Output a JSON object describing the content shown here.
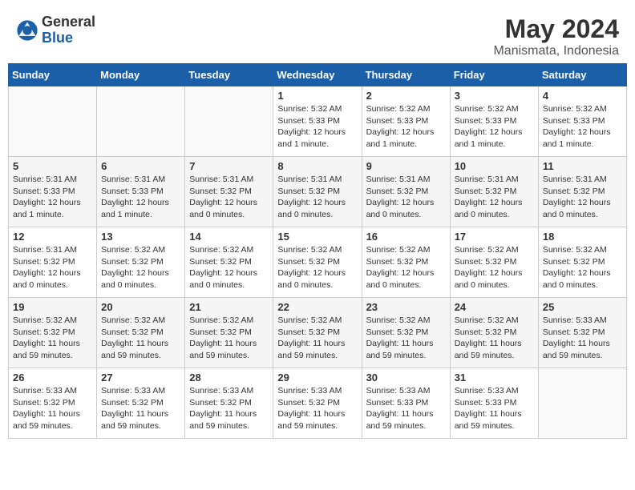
{
  "header": {
    "logo_general": "General",
    "logo_blue": "Blue",
    "month_title": "May 2024",
    "location": "Manismata, Indonesia"
  },
  "weekdays": [
    "Sunday",
    "Monday",
    "Tuesday",
    "Wednesday",
    "Thursday",
    "Friday",
    "Saturday"
  ],
  "weeks": [
    [
      {
        "day": "",
        "info": ""
      },
      {
        "day": "",
        "info": ""
      },
      {
        "day": "",
        "info": ""
      },
      {
        "day": "1",
        "info": "Sunrise: 5:32 AM\nSunset: 5:33 PM\nDaylight: 12 hours\nand 1 minute."
      },
      {
        "day": "2",
        "info": "Sunrise: 5:32 AM\nSunset: 5:33 PM\nDaylight: 12 hours\nand 1 minute."
      },
      {
        "day": "3",
        "info": "Sunrise: 5:32 AM\nSunset: 5:33 PM\nDaylight: 12 hours\nand 1 minute."
      },
      {
        "day": "4",
        "info": "Sunrise: 5:32 AM\nSunset: 5:33 PM\nDaylight: 12 hours\nand 1 minute."
      }
    ],
    [
      {
        "day": "5",
        "info": "Sunrise: 5:31 AM\nSunset: 5:33 PM\nDaylight: 12 hours\nand 1 minute."
      },
      {
        "day": "6",
        "info": "Sunrise: 5:31 AM\nSunset: 5:33 PM\nDaylight: 12 hours\nand 1 minute."
      },
      {
        "day": "7",
        "info": "Sunrise: 5:31 AM\nSunset: 5:32 PM\nDaylight: 12 hours\nand 0 minutes."
      },
      {
        "day": "8",
        "info": "Sunrise: 5:31 AM\nSunset: 5:32 PM\nDaylight: 12 hours\nand 0 minutes."
      },
      {
        "day": "9",
        "info": "Sunrise: 5:31 AM\nSunset: 5:32 PM\nDaylight: 12 hours\nand 0 minutes."
      },
      {
        "day": "10",
        "info": "Sunrise: 5:31 AM\nSunset: 5:32 PM\nDaylight: 12 hours\nand 0 minutes."
      },
      {
        "day": "11",
        "info": "Sunrise: 5:31 AM\nSunset: 5:32 PM\nDaylight: 12 hours\nand 0 minutes."
      }
    ],
    [
      {
        "day": "12",
        "info": "Sunrise: 5:31 AM\nSunset: 5:32 PM\nDaylight: 12 hours\nand 0 minutes."
      },
      {
        "day": "13",
        "info": "Sunrise: 5:32 AM\nSunset: 5:32 PM\nDaylight: 12 hours\nand 0 minutes."
      },
      {
        "day": "14",
        "info": "Sunrise: 5:32 AM\nSunset: 5:32 PM\nDaylight: 12 hours\nand 0 minutes."
      },
      {
        "day": "15",
        "info": "Sunrise: 5:32 AM\nSunset: 5:32 PM\nDaylight: 12 hours\nand 0 minutes."
      },
      {
        "day": "16",
        "info": "Sunrise: 5:32 AM\nSunset: 5:32 PM\nDaylight: 12 hours\nand 0 minutes."
      },
      {
        "day": "17",
        "info": "Sunrise: 5:32 AM\nSunset: 5:32 PM\nDaylight: 12 hours\nand 0 minutes."
      },
      {
        "day": "18",
        "info": "Sunrise: 5:32 AM\nSunset: 5:32 PM\nDaylight: 12 hours\nand 0 minutes."
      }
    ],
    [
      {
        "day": "19",
        "info": "Sunrise: 5:32 AM\nSunset: 5:32 PM\nDaylight: 11 hours\nand 59 minutes."
      },
      {
        "day": "20",
        "info": "Sunrise: 5:32 AM\nSunset: 5:32 PM\nDaylight: 11 hours\nand 59 minutes."
      },
      {
        "day": "21",
        "info": "Sunrise: 5:32 AM\nSunset: 5:32 PM\nDaylight: 11 hours\nand 59 minutes."
      },
      {
        "day": "22",
        "info": "Sunrise: 5:32 AM\nSunset: 5:32 PM\nDaylight: 11 hours\nand 59 minutes."
      },
      {
        "day": "23",
        "info": "Sunrise: 5:32 AM\nSunset: 5:32 PM\nDaylight: 11 hours\nand 59 minutes."
      },
      {
        "day": "24",
        "info": "Sunrise: 5:32 AM\nSunset: 5:32 PM\nDaylight: 11 hours\nand 59 minutes."
      },
      {
        "day": "25",
        "info": "Sunrise: 5:33 AM\nSunset: 5:32 PM\nDaylight: 11 hours\nand 59 minutes."
      }
    ],
    [
      {
        "day": "26",
        "info": "Sunrise: 5:33 AM\nSunset: 5:32 PM\nDaylight: 11 hours\nand 59 minutes."
      },
      {
        "day": "27",
        "info": "Sunrise: 5:33 AM\nSunset: 5:32 PM\nDaylight: 11 hours\nand 59 minutes."
      },
      {
        "day": "28",
        "info": "Sunrise: 5:33 AM\nSunset: 5:32 PM\nDaylight: 11 hours\nand 59 minutes."
      },
      {
        "day": "29",
        "info": "Sunrise: 5:33 AM\nSunset: 5:32 PM\nDaylight: 11 hours\nand 59 minutes."
      },
      {
        "day": "30",
        "info": "Sunrise: 5:33 AM\nSunset: 5:33 PM\nDaylight: 11 hours\nand 59 minutes."
      },
      {
        "day": "31",
        "info": "Sunrise: 5:33 AM\nSunset: 5:33 PM\nDaylight: 11 hours\nand 59 minutes."
      },
      {
        "day": "",
        "info": ""
      }
    ]
  ]
}
